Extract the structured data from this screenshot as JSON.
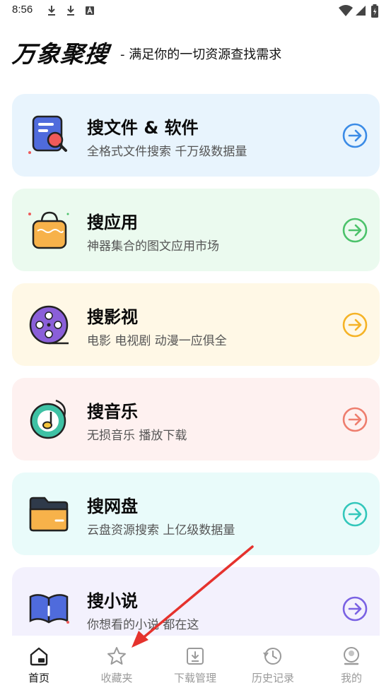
{
  "status_bar": {
    "time": "8:56"
  },
  "header": {
    "brand": "万象聚搜",
    "slogan": "- 满足你的一切资源查找需求"
  },
  "cards": [
    {
      "title": "搜文件 & 软件",
      "subtitle": "全格式文件搜索 千万级数据量",
      "bg": "#e8f4fd",
      "accent": "#3b8be6",
      "icon": "document-search-icon"
    },
    {
      "title": "搜应用",
      "subtitle": "神器集合的图文应用市场",
      "bg": "#ebfaef",
      "accent": "#4cc26b",
      "icon": "shopping-bag-icon"
    },
    {
      "title": "搜影视",
      "subtitle": "电影 电视剧 动漫一应俱全",
      "bg": "#fff8e6",
      "accent": "#f5b326",
      "icon": "film-reel-icon"
    },
    {
      "title": "搜音乐",
      "subtitle": "无损音乐 播放下载",
      "bg": "#fef1f0",
      "accent": "#ee7e6e",
      "icon": "music-note-icon"
    },
    {
      "title": "搜网盘",
      "subtitle": "云盘资源搜索 上亿级数据量",
      "bg": "#e9fbfa",
      "accent": "#33c7bb",
      "icon": "folder-icon"
    },
    {
      "title": "搜小说",
      "subtitle": "你想看的小说 都在这",
      "bg": "#f3f1fd",
      "accent": "#7a62e3",
      "icon": "open-book-icon"
    }
  ],
  "nav": [
    {
      "label": "首页",
      "icon": "home-icon",
      "active": true
    },
    {
      "label": "收藏夹",
      "icon": "star-icon",
      "active": false
    },
    {
      "label": "下载管理",
      "icon": "download-icon",
      "active": false
    },
    {
      "label": "历史记录",
      "icon": "history-icon",
      "active": false
    },
    {
      "label": "我的",
      "icon": "profile-icon",
      "active": false
    }
  ],
  "annotation_color": "#e5322d"
}
